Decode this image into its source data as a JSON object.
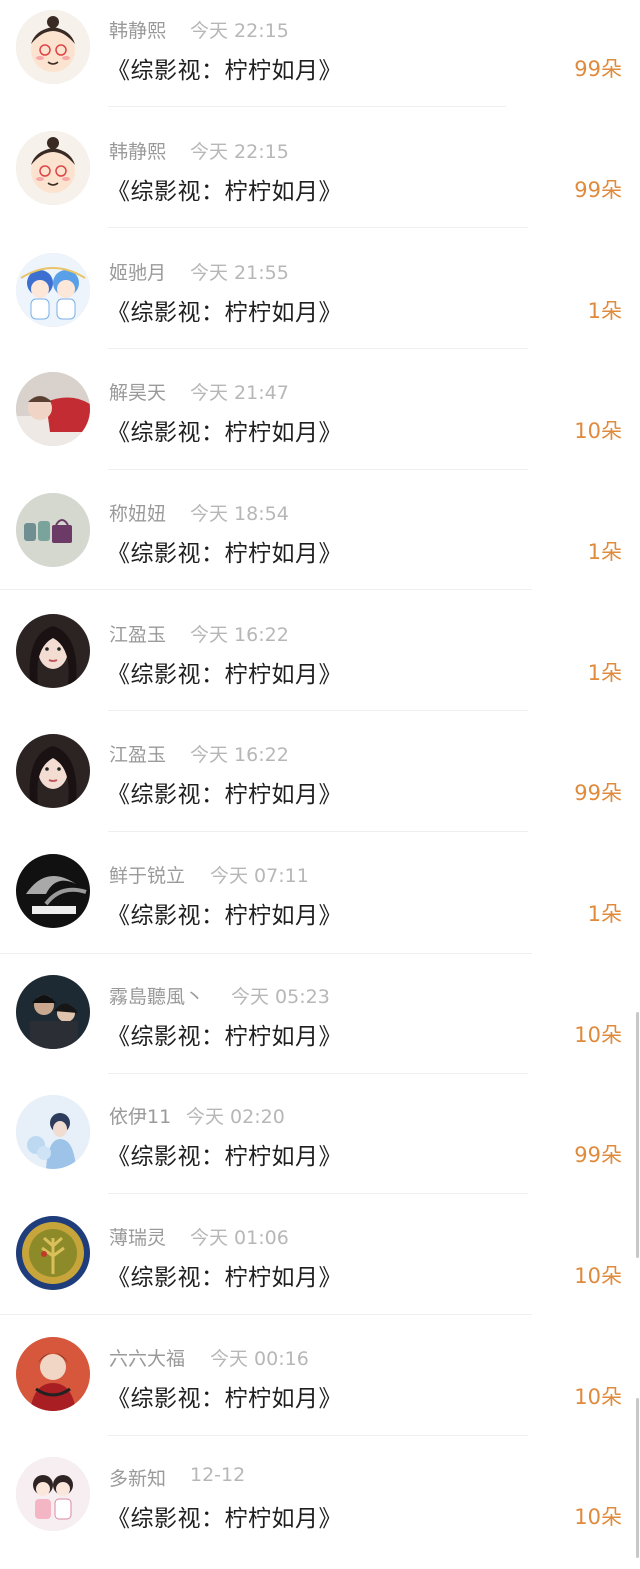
{
  "gift_records": [
    {
      "name": "韩静熙",
      "time": "今天 22:15",
      "title": "《综影视：柠柠如月》",
      "gift": "99朵",
      "avatar_icon": "cartoon-boy-face-icon"
    },
    {
      "name": "韩静熙",
      "time": "今天 22:15",
      "title": "《综影视：柠柠如月》",
      "gift": "99朵",
      "avatar_icon": "cartoon-boy-face-icon"
    },
    {
      "name": "姬驰月",
      "time": "今天 21:55",
      "title": "《综影视：柠柠如月》",
      "gift": "1朵",
      "avatar_icon": "anime-couple-icon"
    },
    {
      "name": "解昊天",
      "time": "今天 21:47",
      "title": "《综影视：柠柠如月》",
      "gift": "10朵",
      "avatar_icon": "baby-photo-icon"
    },
    {
      "name": "称妞妞",
      "time": "今天 18:54",
      "title": "《综影视：柠柠如月》",
      "gift": "1朵",
      "avatar_icon": "toys-photo-icon"
    },
    {
      "name": "江盈玉",
      "time": "今天 16:22",
      "title": "《综影视：柠柠如月》",
      "gift": "1朵",
      "avatar_icon": "girl-portrait-icon"
    },
    {
      "name": "江盈玉",
      "time": "今天 16:22",
      "title": "《综影视：柠柠如月》",
      "gift": "99朵",
      "avatar_icon": "girl-portrait-icon"
    },
    {
      "name": "鲜于锐立",
      "time": "今天 07:11",
      "title": "《综影视：柠柠如月》",
      "gift": "1朵",
      "avatar_icon": "smoke-photo-icon"
    },
    {
      "name": "霧島聽風丶",
      "time": "今天 05:23",
      "title": "《综影视：柠柠如月》",
      "gift": "10朵",
      "avatar_icon": "dark-couple-icon"
    },
    {
      "name": "依伊11",
      "time": "今天 02:20",
      "title": "《综影视：柠柠如月》",
      "gift": "99朵",
      "avatar_icon": "blue-girl-icon"
    },
    {
      "name": "薄瑞灵",
      "time": "今天 01:06",
      "title": "《综影视：柠柠如月》",
      "gift": "10朵",
      "avatar_icon": "gold-coin-icon"
    },
    {
      "name": "六六大福",
      "time": "今天 00:16",
      "title": "《综影视：柠柠如月》",
      "gift": "10朵",
      "avatar_icon": "red-child-icon"
    },
    {
      "name": "多新知",
      "time": "12-12",
      "title": "《综影视：柠柠如月》",
      "gift": "10朵",
      "avatar_icon": "cartoon-girls-icon"
    }
  ],
  "colors": {
    "name": "#9a9a9a",
    "time": "#b7b7b7",
    "title": "#1f1f1f",
    "gift": "#e08a3c",
    "divider": "#efefef"
  }
}
